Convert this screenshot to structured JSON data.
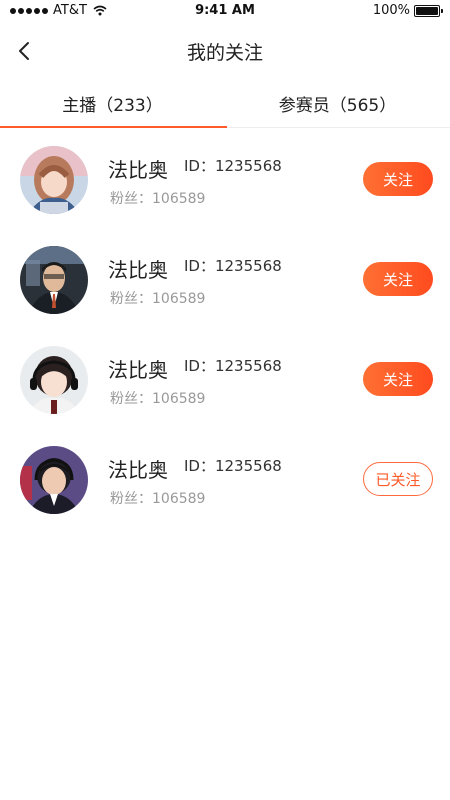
{
  "status_bar": {
    "carrier": "AT&T",
    "time": "9:41 AM",
    "battery_text": "100%",
    "battery_level": 1.0
  },
  "header": {
    "title": "我的关注"
  },
  "tabs": [
    {
      "label": "主播（233）"
    },
    {
      "label": "参赛员（565）"
    }
  ],
  "follow_list": [
    {
      "name": "法比奥",
      "id_text": "ID：1235568",
      "fans_text": "粉丝：106589",
      "button_label": "关注",
      "followed": false
    },
    {
      "name": "法比奥",
      "id_text": "ID：1235568",
      "fans_text": "粉丝：106589",
      "button_label": "关注",
      "followed": false
    },
    {
      "name": "法比奥",
      "id_text": "ID：1235568",
      "fans_text": "粉丝：106589",
      "button_label": "关注",
      "followed": false
    },
    {
      "name": "法比奥",
      "id_text": "ID：1235568",
      "fans_text": "粉丝：106589",
      "button_label": "已关注",
      "followed": true
    }
  ],
  "colors": {
    "accent": "#ff5a2a",
    "secondary_text": "#999999"
  }
}
